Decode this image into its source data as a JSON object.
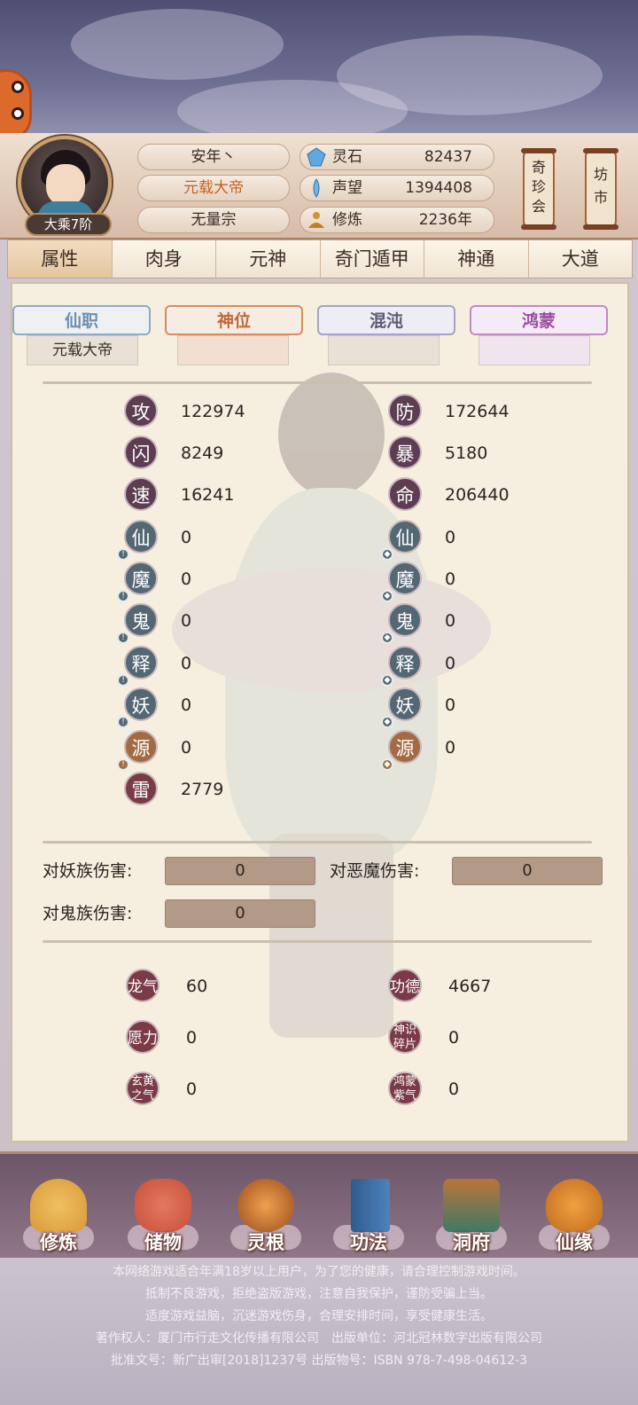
{
  "player": {
    "name": "安年丶",
    "title": "元载大帝",
    "sect": "无量宗",
    "realm": "大乘7阶"
  },
  "resources": [
    {
      "icon": "spirit-stone-icon",
      "label": "灵石",
      "value": "82437"
    },
    {
      "icon": "reputation-icon",
      "label": "声望",
      "value": "1394408"
    },
    {
      "icon": "cultivation-icon",
      "label": "修炼",
      "value": "2236年"
    }
  ],
  "shortcuts": {
    "treasure": "奇珍会",
    "market": "坊市"
  },
  "tabs": [
    "属性",
    "肉身",
    "元神",
    "奇门遁甲",
    "神通",
    "大道"
  ],
  "active_tab": "属性",
  "titles": [
    {
      "label": "仙职",
      "value": "元载大帝",
      "color": "#6e8fae"
    },
    {
      "label": "神位",
      "value": "",
      "color": "#c06a3a"
    },
    {
      "label": "混沌",
      "value": "",
      "color": "#5d5a72"
    },
    {
      "label": "鸿蒙",
      "value": "",
      "color": "#9c4fa0"
    }
  ],
  "stats_left": [
    {
      "badge": "攻",
      "value": "122974"
    },
    {
      "badge": "闪",
      "value": "8249"
    },
    {
      "badge": "速",
      "value": "16241"
    },
    {
      "badge": "仙",
      "value": "0"
    },
    {
      "badge": "魔",
      "value": "0"
    },
    {
      "badge": "鬼",
      "value": "0"
    },
    {
      "badge": "释",
      "value": "0"
    },
    {
      "badge": "妖",
      "value": "0"
    },
    {
      "badge": "源",
      "value": "0"
    },
    {
      "badge": "雷",
      "value": "2779"
    }
  ],
  "stats_right": [
    {
      "badge": "防",
      "value": "172644"
    },
    {
      "badge": "暴",
      "value": "5180"
    },
    {
      "badge": "命",
      "value": "206440"
    },
    {
      "badge": "仙",
      "value": "0"
    },
    {
      "badge": "魔",
      "value": "0"
    },
    {
      "badge": "鬼",
      "value": "0"
    },
    {
      "badge": "释",
      "value": "0"
    },
    {
      "badge": "妖",
      "value": "0"
    },
    {
      "badge": "源",
      "value": "0"
    }
  ],
  "damage": [
    {
      "label": "对妖族伤害:",
      "value": "0"
    },
    {
      "label": "对恶魔伤害:",
      "value": "0"
    },
    {
      "label": "对鬼族伤害:",
      "value": "0"
    }
  ],
  "extra_left": [
    {
      "badge": "龙气",
      "value": "60"
    },
    {
      "badge": "愿力",
      "value": "0"
    },
    {
      "badge": "玄黄之气",
      "value": "0"
    }
  ],
  "extra_right": [
    {
      "badge": "功德",
      "value": "4667"
    },
    {
      "badge": "神识碎片",
      "value": "0"
    },
    {
      "badge": "鸿蒙紫气",
      "value": "0"
    }
  ],
  "menu": [
    {
      "label": "修炼",
      "icon": "meditate-icon",
      "color": "#d89a3a"
    },
    {
      "label": "储物",
      "icon": "storage-bag-icon",
      "color": "#c8503a"
    },
    {
      "label": "灵根",
      "icon": "spirit-root-icon",
      "color": "#c9742b"
    },
    {
      "label": "功法",
      "icon": "book-icon",
      "color": "#3d6fa5"
    },
    {
      "label": "洞府",
      "icon": "cave-house-icon",
      "color": "#3f7a64"
    },
    {
      "label": "仙缘",
      "icon": "gourd-icon",
      "color": "#d07a2c"
    }
  ],
  "footer": [
    "本网络游戏适合年满18岁以上用户，为了您的健康，请合理控制游戏时间。",
    "抵制不良游戏，拒绝盗版游戏，注意自我保护，谨防受骗上当。",
    "适度游戏益脑，沉迷游戏伤身，合理安排时间，享受健康生活。",
    "著作权人：厦门市行走文化传播有限公司　出版单位：河北冠林数字出版有限公司",
    "批准文号：新广出审[2018]1237号 出版物号：ISBN 978-7-498-04612-3"
  ]
}
